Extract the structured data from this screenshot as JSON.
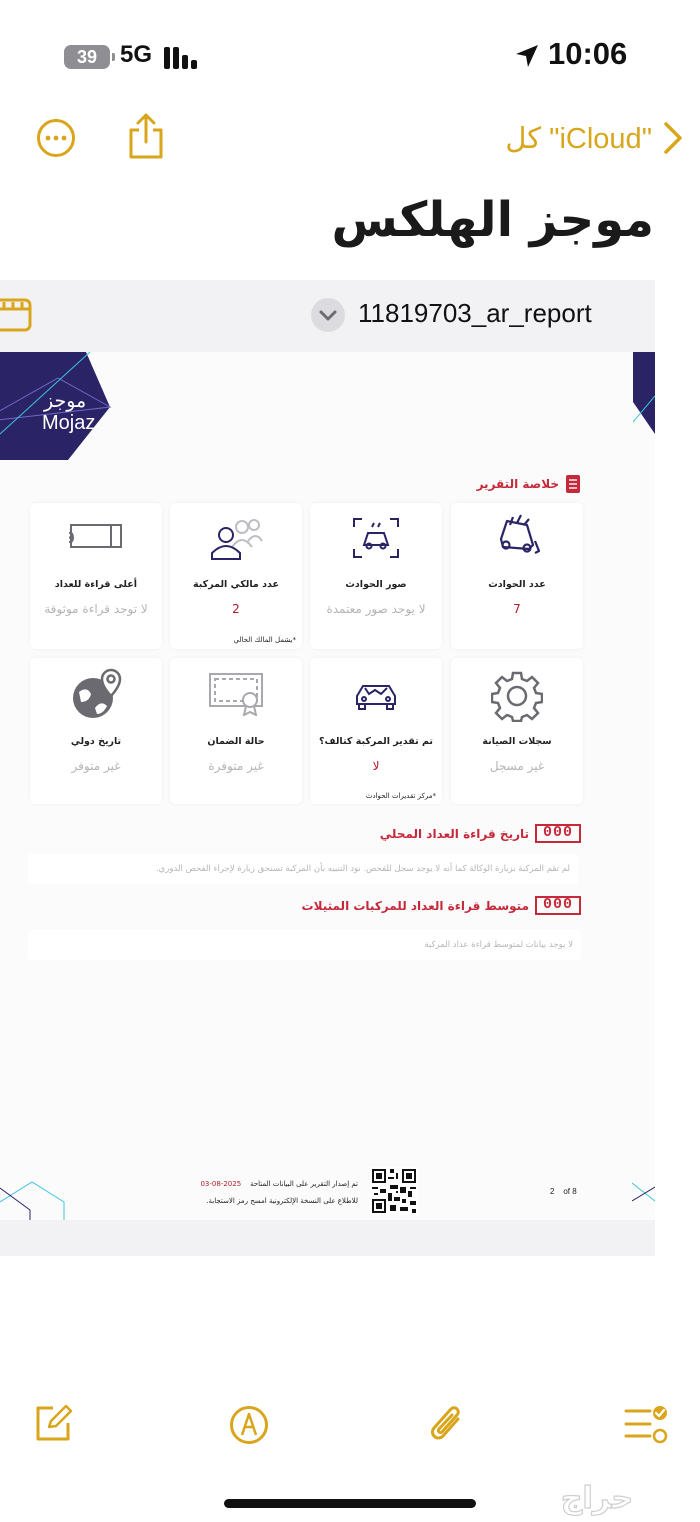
{
  "status_bar": {
    "battery": "39",
    "network": "5G",
    "time": "10:06"
  },
  "nav": {
    "back_label": "كل \"iCloud\"",
    "more_icon": "ellipsis-circle-icon",
    "share_icon": "share-icon",
    "accent_color": "#d9a51b"
  },
  "note": {
    "title": "موجز الهلكس"
  },
  "attachment": {
    "filename": "11819703_ar_report"
  },
  "report": {
    "logo_ar": "موجز",
    "logo_en": "Mojaz",
    "summary_title": "خلاصة التقرير",
    "cards": [
      {
        "title": "عدد الحوادث",
        "value": "7",
        "value_style": "red",
        "icon": "crashed-car-icon"
      },
      {
        "title": "صور الحوادث",
        "value": "لا يوجد صور معتمدة",
        "value_style": "grey",
        "icon": "car-photo-icon"
      },
      {
        "title": "عدد مالكي المركبة",
        "value": "2",
        "value_style": "red",
        "note": "*يشمل المالك الحالي",
        "icon": "owners-icon"
      },
      {
        "title": "أعلى قراءة للعداد",
        "value": "لا توجد قراءة موثوقة",
        "value_style": "grey",
        "icon": "odometer-icon"
      },
      {
        "title": "سجلات الصيانة",
        "value": "غير مسجل",
        "value_style": "grey",
        "icon": "gear-icon"
      },
      {
        "title": "تم تقدير المركبة كتالف؟",
        "value": "لا",
        "value_style": "red",
        "note": "*مركز تقديرات الحوادث",
        "icon": "damaged-car-icon"
      },
      {
        "title": "حالة الضمان",
        "value": "غير متوفرة",
        "value_style": "grey",
        "icon": "warranty-certificate-icon"
      },
      {
        "title": "تاريخ دولي",
        "value": "غير متوفر",
        "value_style": "grey",
        "icon": "globe-pin-icon"
      }
    ],
    "odometer_icon_text": "000",
    "local_odometer_title": "تاريخ قراءة العداد المحلي",
    "local_odometer_note": "لم تقم المركبة بزيارة الوكالة كما أنه لا يوجد سجل للفحص. نود التنبيه بأن المركبة تستحق زيارة لإجراء الفحص الدوري.",
    "similar_odometer_title": "متوسط قراءة العداد للمركبات المثيلات",
    "similar_odometer_note": "لا يوجد بيانات لمتوسط قراءة عداد المركبة",
    "footer_issued": "تم إصدار التقرير على البيانات المتاحة",
    "footer_date": "2025-08-03",
    "footer_scan": "للاطلاع على النسخة الإلكترونية امسح رمز الاستجابة.",
    "page_current": "2",
    "page_of": "of 8",
    "brand_red": "#c62a3a",
    "brand_navy": "#2a2466"
  },
  "toolbar": {
    "compose_icon": "compose-icon",
    "markup_icon": "markup-pen-icon",
    "attach_icon": "paperclip-icon",
    "checklist_icon": "checklist-icon"
  },
  "watermark_text": "حراج"
}
